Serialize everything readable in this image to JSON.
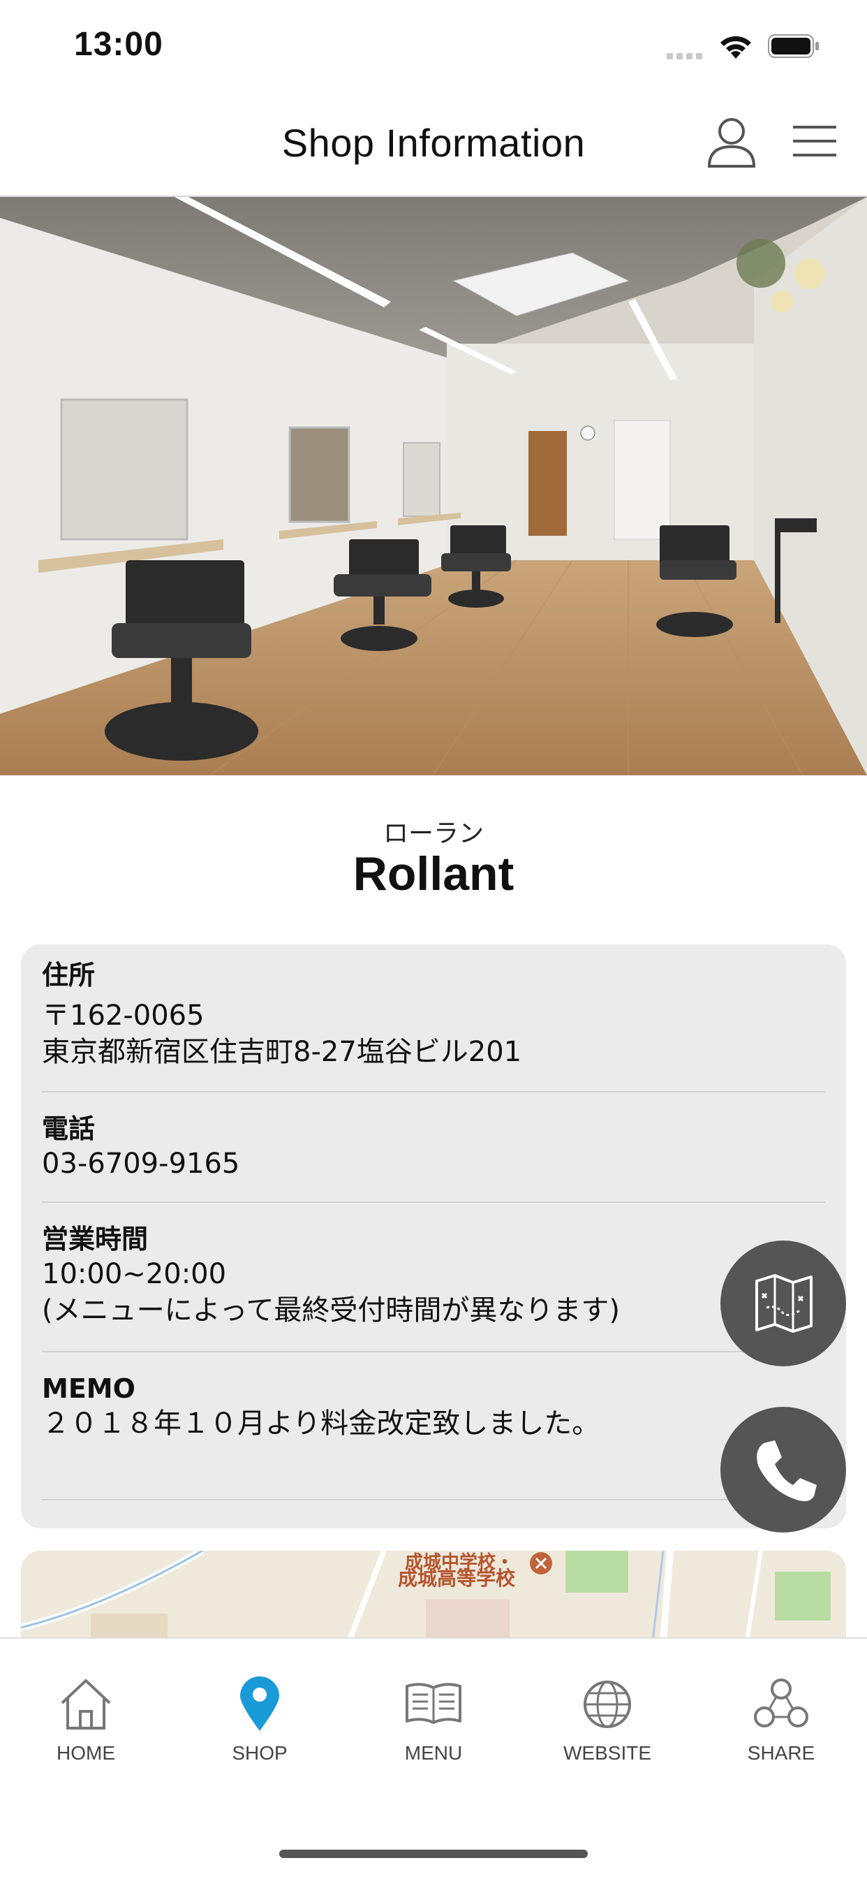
{
  "status_bar": {
    "time": "13:00"
  },
  "header": {
    "title": "Shop Information",
    "user_icon": "person-outline-icon",
    "menu_icon": "hamburger-menu-icon"
  },
  "shop": {
    "kana": "ローラン",
    "name": "Rollant"
  },
  "info": {
    "address": {
      "label": "住所",
      "postal": "〒162-0065",
      "street": "東京都新宿区住吉町8-27塩谷ビル201"
    },
    "phone": {
      "label": "電話",
      "number": "03-6709-9165"
    },
    "hours": {
      "label": "営業時間",
      "time": "10:00~20:00",
      "note": "(メニューによって最終受付時間が異なります)"
    },
    "memo": {
      "label": "MEMO",
      "text": "２０１８年１０月より料金改定致しました。"
    }
  },
  "fabs": {
    "map_icon": "map-icon",
    "phone_icon": "phone-icon"
  },
  "map": {
    "label1": "成城中学校・",
    "label2": "成城高等学校"
  },
  "tabs": [
    {
      "label": "HOME",
      "icon": "house-icon"
    },
    {
      "label": "SHOP",
      "icon": "map-pin-icon"
    },
    {
      "label": "MENU",
      "icon": "book-icon"
    },
    {
      "label": "WEBSITE",
      "icon": "globe-icon"
    },
    {
      "label": "SHARE",
      "icon": "share-nodes-icon"
    }
  ],
  "colors": {
    "accent": "#1a9ad6",
    "fab": "#555555",
    "card": "#ebebeb"
  }
}
